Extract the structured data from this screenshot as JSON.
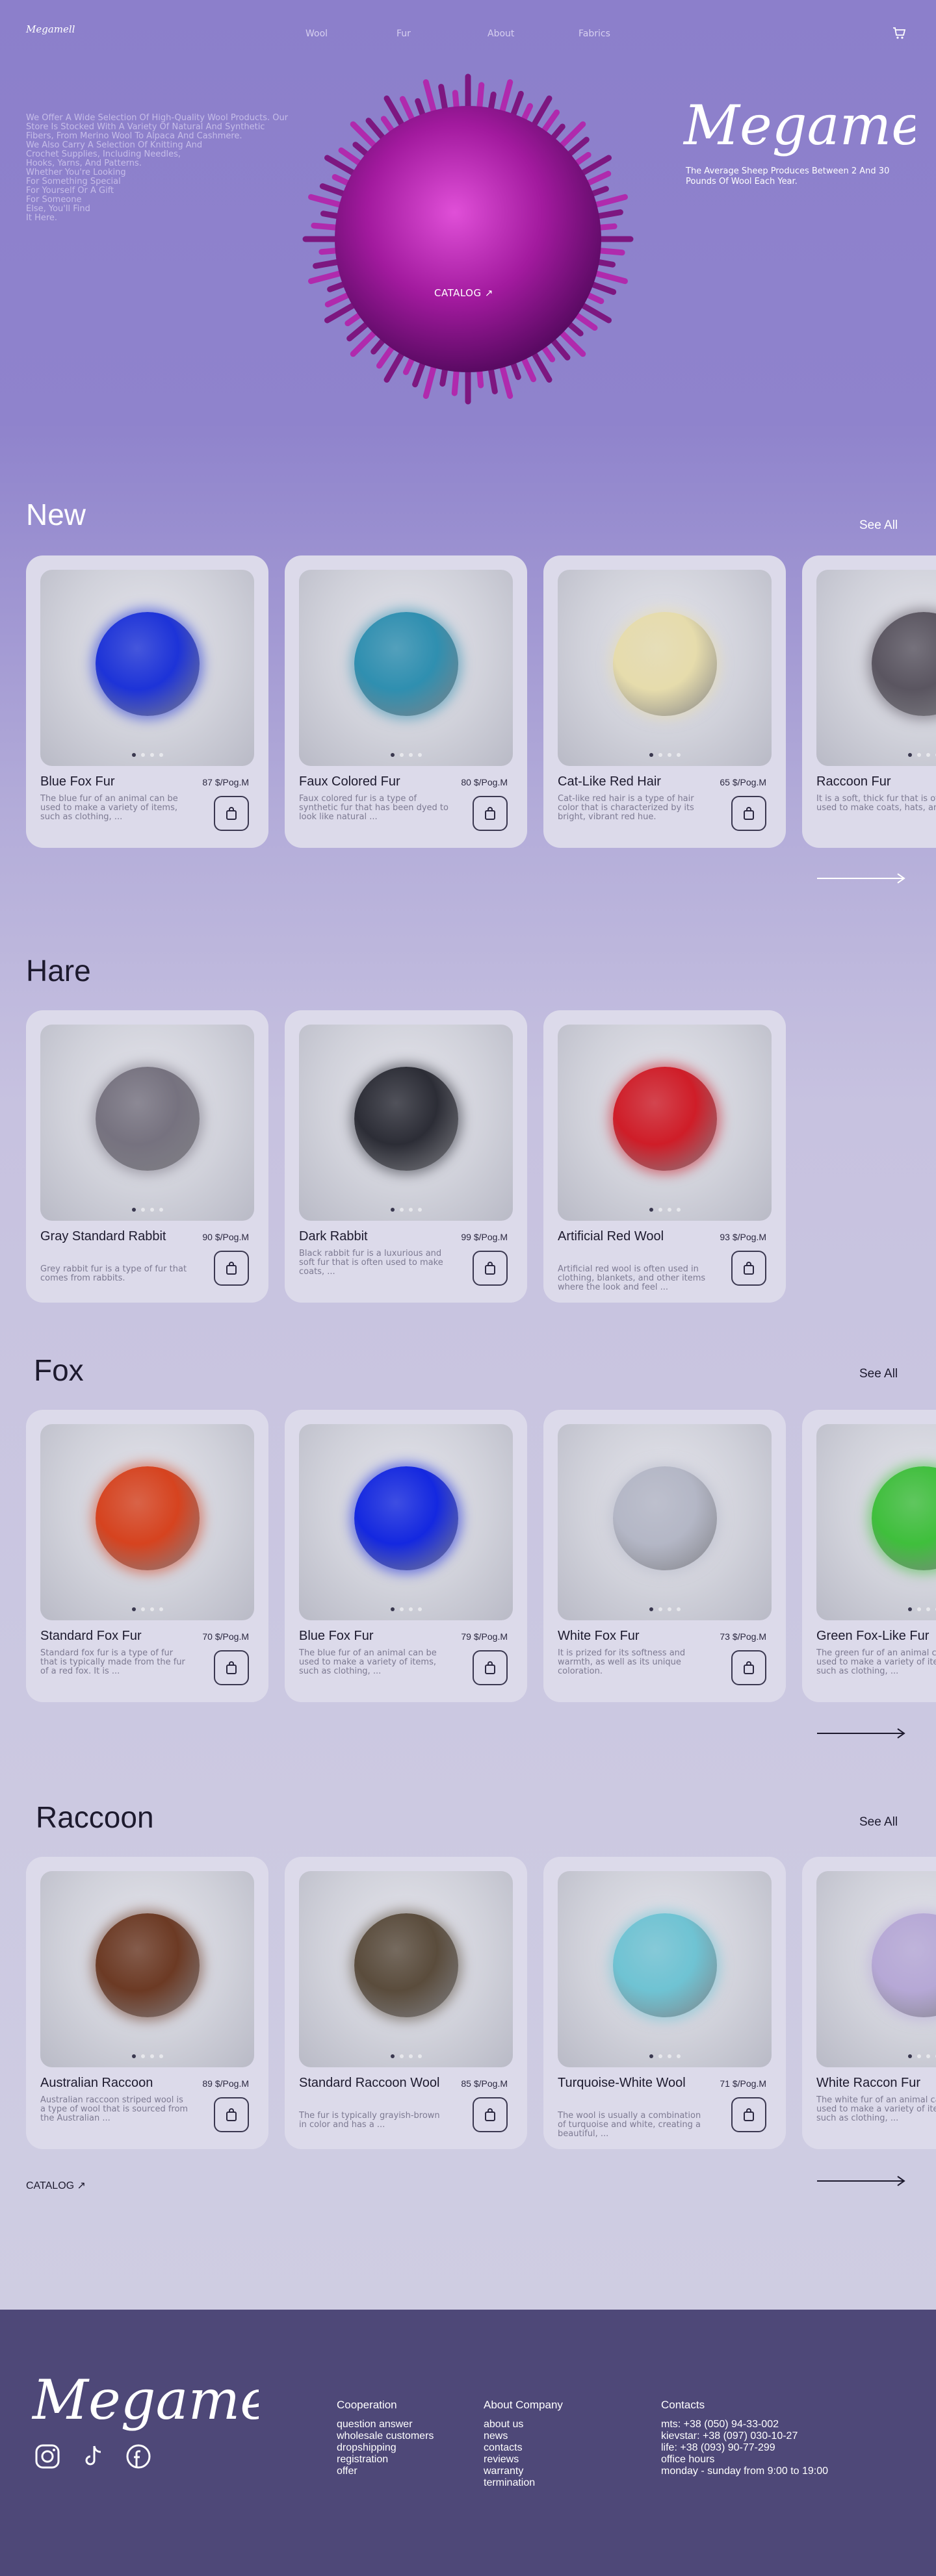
{
  "header": {
    "logo": "Megamell",
    "nav": [
      "Wool",
      "Fur",
      "About",
      "Fabrics"
    ],
    "cart_icon": "cart-icon"
  },
  "hero": {
    "lines": [
      "We Offer A Wide Selection Of High-Quality Wool Products. Our",
      "Store Is Stocked With A Variety Of Natural And Synthetic",
      "Fibers, From Merino Wool To Alpaca And Cashmere.",
      "We Also Carry A Selection Of Knitting And",
      "Crochet Supplies, Including Needles,",
      "Hooks, Yarns, And Patterns.",
      "Whether You're Looking",
      "For Something Special",
      "For Yourself Or A Gift",
      "For Someone",
      "Else, You'll Find",
      "It Here."
    ],
    "catalog": "CATALOG ↗",
    "brand": "Megamell",
    "subtitle": "The Average Sheep Produces Between 2 And 30 Pounds Of Wool Each Year."
  },
  "sections": {
    "new": {
      "title": "New",
      "see_all": "See All",
      "cards": [
        {
          "name": "Blue Fox Fur",
          "price": "87 $/Pog.M",
          "desc": "The blue fur of an animal can be used to make a variety of items, such as clothing, ...",
          "color": "#1d33d8"
        },
        {
          "name": "Faux Colored Fur",
          "price": "80 $/Pog.M",
          "desc": "Faux colored fur is a type of synthetic fur that has been dyed to look like natural ...",
          "color": "#2f8fb0"
        },
        {
          "name": "Cat-Like Red Hair",
          "price": "65 $/Pog.M",
          "desc": "Cat-like red hair is a type of hair color that is characterized by its bright, vibrant red hue.",
          "color": "#e6dcac"
        },
        {
          "name": "Raccoon Fur",
          "price": "",
          "desc": "It is a soft, thick fur that is often used to make coats, hats, and ...",
          "color": "#5a5560"
        }
      ]
    },
    "hare": {
      "title": "Hare",
      "cards": [
        {
          "name": "Gray Standard Rabbit",
          "price": "90 $/Pog.M",
          "desc": "Grey rabbit fur is a type of fur that comes from rabbits.",
          "color": "#76727f"
        },
        {
          "name": "Dark Rabbit",
          "price": "99 $/Pog.M",
          "desc": "Black rabbit fur is a luxurious and soft fur that is often used to make coats, ...",
          "color": "#2c2d36"
        },
        {
          "name": "Artificial Red Wool",
          "price": "93 $/Pog.M",
          "desc": "Artificial red wool is often used in clothing, blankets, and other items where the look and feel ...",
          "color": "#cf1d28"
        }
      ]
    },
    "fox": {
      "title": "Fox",
      "see_all": "See All",
      "cards": [
        {
          "name": "Standard Fox Fur",
          "price": "70 $/Pog.M",
          "desc": "Standard fox fur is a type of fur that is typically made from the fur of a red fox. It is ...",
          "color": "#d6431f"
        },
        {
          "name": "Blue Fox Fur",
          "price": "79 $/Pog.M",
          "desc": "The blue fur of an animal can be used to make a variety of items, such as clothing, ...",
          "color": "#1428e0"
        },
        {
          "name": "White Fox Fur",
          "price": "73 $/Pog.M",
          "desc": "It is prized for its softness and warmth, as well as its unique coloration.",
          "color": "#b4b7c6"
        },
        {
          "name": "Green Fox-Like Fur",
          "price": "",
          "desc": "The green fur of an animal can be used to make a variety of items, such as clothing, ...",
          "color": "#3fbf3c"
        }
      ]
    },
    "raccoon": {
      "title": "Raccoon",
      "see_all": "See All",
      "cards": [
        {
          "name": "Australian Raccoon",
          "price": "89 $/Pog.M",
          "desc": "Australian raccoon striped wool is a type of wool that is sourced from the Australian ...",
          "color": "#6c3a24"
        },
        {
          "name": "Standard Raccoon Wool",
          "price": "85 $/Pog.M",
          "desc": "The fur is typically grayish-brown in color and has a ...",
          "color": "#5a4c3c"
        },
        {
          "name": "Turquoise-White Wool",
          "price": "71 $/Pog.M",
          "desc": "The wool is usually a combination of turquoise and white, creating a beautiful, ...",
          "color": "#6fc3d3"
        },
        {
          "name": "White Raccon Fur",
          "price": "",
          "desc": "The white fur of an animal can be used to make a variety of items, such as clothing, ...",
          "color": "#b6a8d6"
        }
      ]
    }
  },
  "catalog_bottom": "CATALOG ↗",
  "footer": {
    "logo": "Megamell",
    "socials": [
      "instagram-icon",
      "tiktok-icon",
      "facebook-icon"
    ],
    "cooperation": {
      "title": "Cooperation",
      "links": [
        "question answer",
        "wholesale customers",
        "dropshipping",
        "registration",
        "offer"
      ]
    },
    "about": {
      "title": "About Company",
      "links": [
        "about us",
        "news",
        "contacts",
        "reviews",
        "warranty",
        "termination"
      ]
    },
    "contacts": {
      "title": "Contacts",
      "lines": [
        "mts: +38 (050) 94-33-002",
        "kievstar: +38 (097) 030-10-27",
        "life: +38 (093) 90-77-299",
        "office hours",
        "monday - sunday from 9:00 to 19:00"
      ]
    }
  }
}
